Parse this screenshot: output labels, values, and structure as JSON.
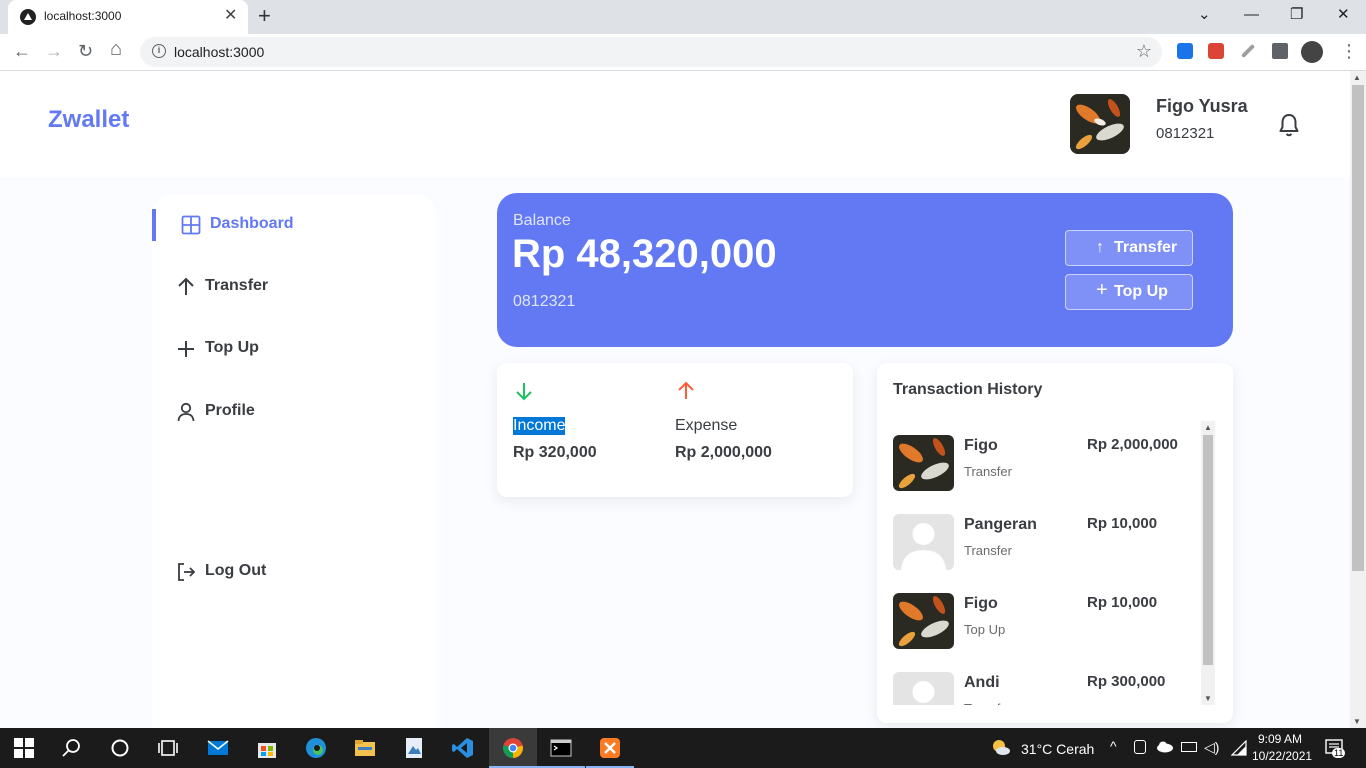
{
  "browser": {
    "tab_title": "localhost:3000",
    "tab_close": "✕",
    "new_tab": "+",
    "url": "localhost:3000",
    "window_controls": [
      "⌄",
      "—",
      "❐",
      "✕"
    ],
    "nav": {
      "back": "←",
      "forward": "→",
      "reload": "↻",
      "home": "⌂"
    },
    "info_glyph": "i",
    "star": "☆",
    "menu": "⋮"
  },
  "header": {
    "brand": "Zwallet",
    "user_name": "Figo Yusra",
    "user_phone": "0812321"
  },
  "sidebar": {
    "items": [
      {
        "label": "Dashboard",
        "icon": "grid-icon"
      },
      {
        "label": "Transfer",
        "icon": "arrow-up-icon"
      },
      {
        "label": "Top Up",
        "icon": "plus-icon"
      },
      {
        "label": "Profile",
        "icon": "user-icon"
      }
    ],
    "logout": "Log Out"
  },
  "balance": {
    "label": "Balance",
    "amount": "Rp 48,320,000",
    "phone": "0812321",
    "transfer_label": "Transfer",
    "topup_label": "Top Up"
  },
  "summary": {
    "income_label": "Income",
    "income_value": "Rp 320,000",
    "expense_label": "Expense",
    "expense_value": "Rp 2,000,000",
    "income_color": "#1ec15f",
    "expense_color": "#ff5b37"
  },
  "history": {
    "title": "Transaction History",
    "items": [
      {
        "name": "Figo",
        "type": "Transfer",
        "amount": "Rp 2,000,000",
        "thumb": "koi-photo"
      },
      {
        "name": "Pangeran",
        "type": "Transfer",
        "amount": "Rp 10,000",
        "thumb": "default-avatar"
      },
      {
        "name": "Figo",
        "type": "Top Up",
        "amount": "Rp 10,000",
        "thumb": "koi-photo"
      },
      {
        "name": "Andi",
        "type": "Transfer",
        "amount": "Rp 300,000",
        "thumb": "default-avatar"
      }
    ]
  },
  "taskbar": {
    "weather": "31°C  Cerah",
    "time": "9:09 AM",
    "date": "10/22/2021",
    "notification_count": "11"
  },
  "colors": {
    "accent": "#6379f4",
    "text": "#3a3d42",
    "page_bg": "#fafcff"
  }
}
